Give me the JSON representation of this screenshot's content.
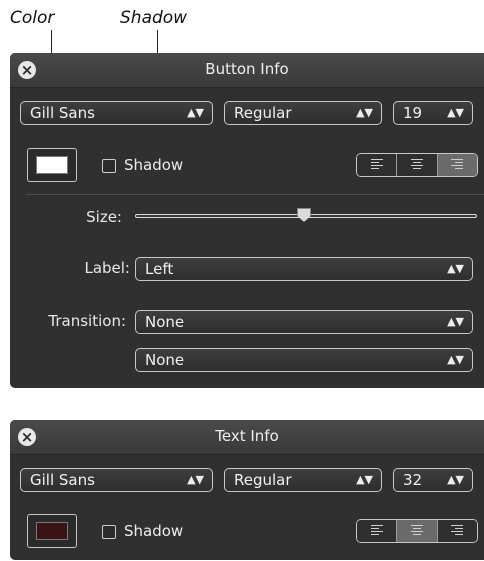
{
  "callouts": {
    "color": "Color",
    "shadow": "Shadow"
  },
  "button_info": {
    "title": "Button Info",
    "font_family": "Gill Sans",
    "font_style": "Regular",
    "font_size": "19",
    "color_swatch": "#ffffff",
    "shadow_label": "Shadow",
    "shadow_checked": false,
    "alignment_selected": "right",
    "size_label": "Size:",
    "size_value": 0.5,
    "label_label": "Label:",
    "label_value": "Left",
    "transition_label": "Transition:",
    "transition_value_1": "None",
    "transition_value_2": "None"
  },
  "text_info": {
    "title": "Text Info",
    "font_family": "Gill Sans",
    "font_style": "Regular",
    "font_size": "32",
    "color_swatch": "#3a1414",
    "shadow_label": "Shadow",
    "shadow_checked": false,
    "alignment_selected": "center"
  },
  "icons": {
    "close": "close-icon",
    "popup_arrows": "up-down-arrows-icon",
    "align_left": "align-left-icon",
    "align_center": "align-center-icon",
    "align_right": "align-right-icon"
  }
}
